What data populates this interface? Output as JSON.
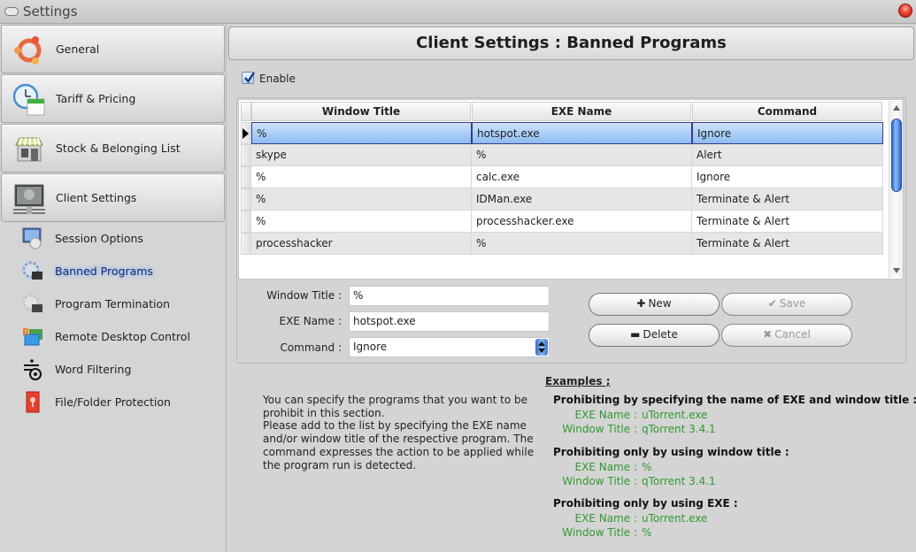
{
  "window": {
    "title": "Settings"
  },
  "sidebar": {
    "main_items": [
      {
        "label": "General",
        "icon": "ubuntu-logo-icon"
      },
      {
        "label": "Tariff & Pricing",
        "icon": "clock-calendar-icon"
      },
      {
        "label": "Stock & Belonging List",
        "icon": "store-icon"
      },
      {
        "label": "Client Settings",
        "icon": "monitor-icon"
      }
    ],
    "sub_items": [
      {
        "label": "Session Options",
        "icon": "session-gear-icon"
      },
      {
        "label": "Banned Programs",
        "icon": "gear-window-icon",
        "active": true
      },
      {
        "label": "Program Termination",
        "icon": "gear-window-gray-icon"
      },
      {
        "label": "Remote Desktop Control",
        "icon": "remote-desktop-icon"
      },
      {
        "label": "Word Filtering",
        "icon": "word-filter-icon"
      },
      {
        "label": "File/Folder Protection",
        "icon": "lock-folder-icon"
      }
    ]
  },
  "header": {
    "title": "Client Settings : Banned Programs"
  },
  "enable": {
    "label": "Enable",
    "checked": true
  },
  "grid": {
    "columns": [
      "Window Title",
      "EXE Name",
      "Command"
    ],
    "rows": [
      [
        "%",
        "hotspot.exe",
        "Ignore"
      ],
      [
        "skype",
        "%",
        "Alert"
      ],
      [
        "%",
        "calc.exe",
        "Ignore"
      ],
      [
        "%",
        "IDMan.exe",
        "Terminate & Alert"
      ],
      [
        "%",
        "processhacker.exe",
        "Terminate & Alert"
      ],
      [
        "processhacker",
        "%",
        "Terminate & Alert"
      ]
    ],
    "selected_row": 0
  },
  "form": {
    "window_title_label": "Window Title :",
    "window_title_value": "%",
    "exe_name_label": "EXE Name :",
    "exe_name_value": "hotspot.exe",
    "command_label": "Command :",
    "command_value": "Ignore"
  },
  "buttons": {
    "new": {
      "glyph": "✚",
      "label": "New"
    },
    "save": {
      "glyph": "✔",
      "label": "Save",
      "disabled": true
    },
    "delete": {
      "glyph": "▬",
      "label": "Delete"
    },
    "cancel": {
      "glyph": "✖",
      "label": "Cancel",
      "disabled": true
    }
  },
  "description": "You can specify the programs that you want to be prohibit in this section.\nPlease add to the list by specifying the EXE name and/or window title of the respective program. The command expresses the action to be applied while the program run is detected.",
  "examples": {
    "title": "Examples ;",
    "blocks": [
      {
        "heading": "Prohibiting by specifying the name of EXE and window title :",
        "exe_key": "EXE Name :",
        "exe_value": "uTorrent.exe",
        "title_key": "Window Title :",
        "title_value": "qTorrent 3.4.1"
      },
      {
        "heading": "Prohibiting only by using window title :",
        "exe_key": "EXE Name :",
        "exe_value": "%",
        "title_key": "Window Title :",
        "title_value": "qTorrent 3.4.1"
      },
      {
        "heading": "Prohibiting only by using EXE :",
        "exe_key": "EXE Name :",
        "exe_value": "uTorrent.exe",
        "title_key": "Window Title :",
        "title_value": "%"
      }
    ]
  },
  "colors": {
    "selection": "#a8cdf5",
    "example_green": "#2f9a2f",
    "scroll_thumb": "#4a86e0"
  }
}
